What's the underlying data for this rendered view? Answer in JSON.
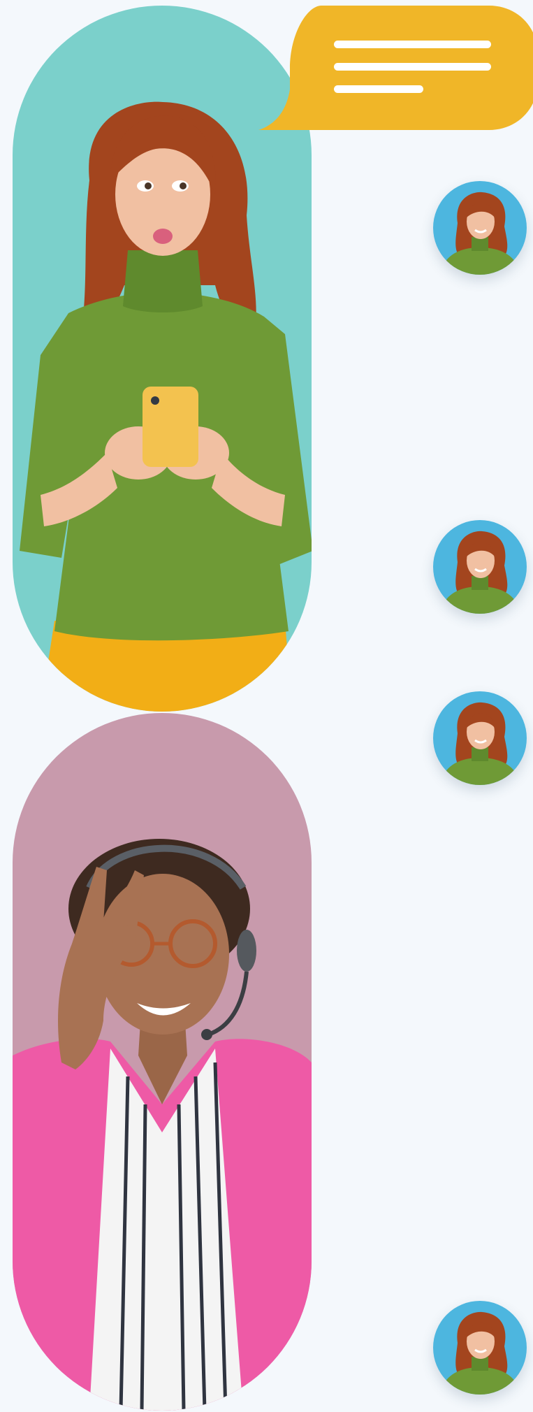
{
  "colors": {
    "page_background": "#f4f8fc",
    "capsule_teal": "#7bd0cb",
    "capsule_mauve": "#c89aac",
    "bubble_yellow": "#f0b628",
    "avatar_blue": "#4db6df"
  },
  "hero_photo_1": {
    "icon": "woman-with-phone-photo",
    "shirt_color": "#6f9a36",
    "hair_color": "#a3451e",
    "phone_color": "#f3c24f",
    "pants_color": "#f2ae16"
  },
  "hero_photo_2": {
    "icon": "woman-headset-ok-gesture-photo",
    "jacket_color": "#ee5aa6",
    "hair_color": "#3e2a20"
  },
  "chat_bubble": {
    "icon": "chat-bubble-icon",
    "text_lines": 3
  },
  "avatars": [
    {
      "icon": "agent-avatar"
    },
    {
      "icon": "agent-avatar"
    },
    {
      "icon": "agent-avatar"
    },
    {
      "icon": "agent-avatar"
    }
  ]
}
